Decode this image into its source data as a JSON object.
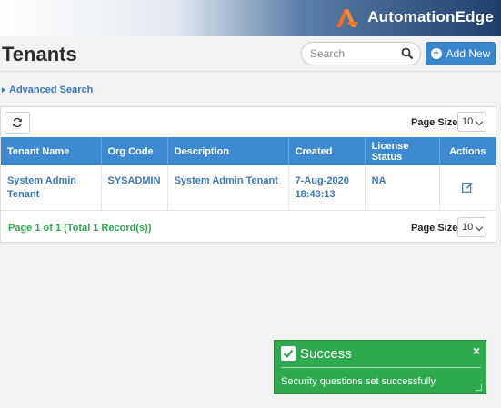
{
  "brand": {
    "name": "AutomationEdge",
    "logo_icon": "automationedge-logo"
  },
  "page": {
    "title": "Tenants"
  },
  "search": {
    "placeholder": "Search"
  },
  "toolbar": {
    "add_new_label": "Add New",
    "advanced_search_label": "Advanced Search"
  },
  "page_size": {
    "label": "Page Size",
    "value": "10"
  },
  "table": {
    "columns": [
      "Tenant Name",
      "Org Code",
      "Description",
      "Created",
      "License Status",
      "Actions"
    ],
    "rows": [
      {
        "tenant_name_line1": "System Admin",
        "tenant_name_line2": "Tenant",
        "org_code": "SYSADMIN",
        "description": "System Admin Tenant",
        "created_date": "7-Aug-2020",
        "created_time": "18:43:13",
        "license_status": "NA",
        "action_icon": "edit-icon"
      }
    ]
  },
  "pager": {
    "summary": "Page 1 of 1 (Total 1 Record(s))"
  },
  "toast": {
    "title": "Success",
    "message": "Security questions set successfully",
    "close_symbol": "×"
  },
  "colors": {
    "primary": "#3d8ad1",
    "link": "#3a78b8",
    "success": "#2fa84f",
    "accent": "#f37021"
  }
}
